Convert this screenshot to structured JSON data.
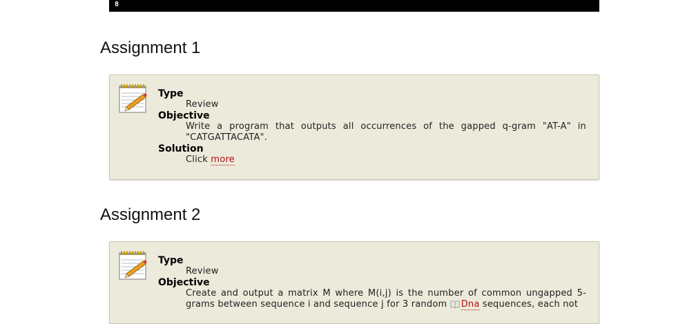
{
  "code_bar": {
    "text": "8"
  },
  "assignments": [
    {
      "title": "Assignment 1",
      "type_label": "Type",
      "type_value": "Review",
      "objective_label": "Objective",
      "objective_text": "Write a program that outputs all occurrences of the gapped q-gram \"AT-A\" in \"CATGATTACATA\".",
      "solution_label": "Solution",
      "solution_prefix": "Click",
      "solution_link": "more"
    },
    {
      "title": "Assignment 2",
      "type_label": "Type",
      "type_value": "Review",
      "objective_label": "Objective",
      "objective_text_before": "Create and output a matrix M where M(i,j) is the number of common ungapped 5-grams between sequence i and sequence j for 3 random",
      "objective_link": "Dna",
      "objective_text_after": "sequences, each not"
    }
  ],
  "icons": {
    "notepad": "notepad-pencil-icon",
    "book": "book-icon"
  },
  "colors": {
    "box_background": "#eceadb",
    "link": "#b01010"
  }
}
